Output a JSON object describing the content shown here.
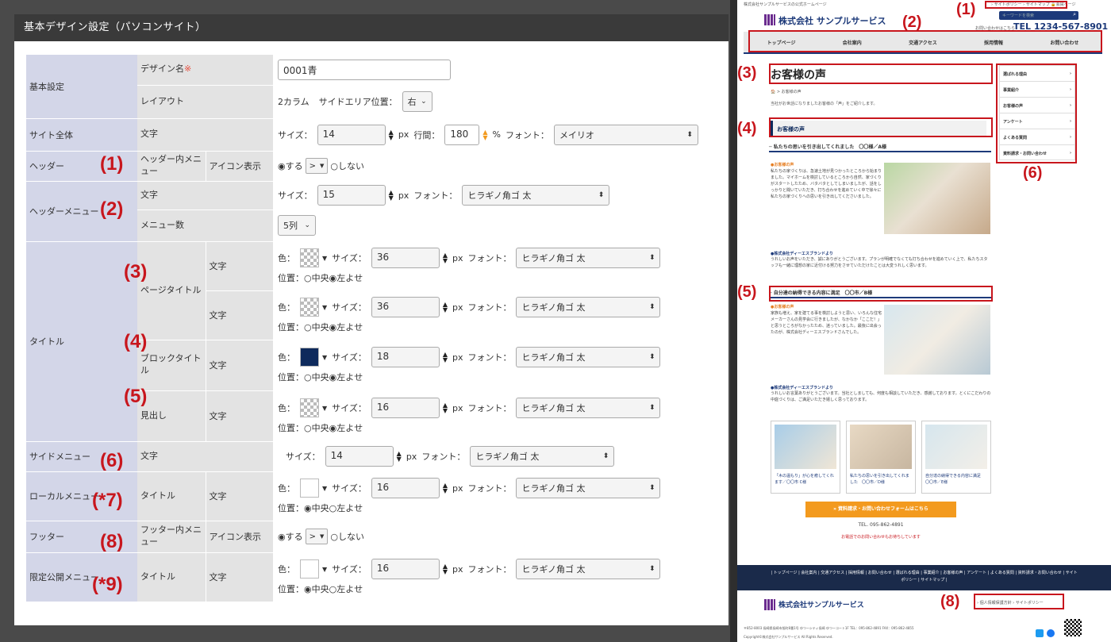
{
  "modal": {
    "title": "基本デザイン設定（パソコンサイト）"
  },
  "annotations": [
    "(1)",
    "(2)",
    "(3)",
    "(4)",
    "(5)",
    "(6)",
    "(*7)",
    "(8)",
    "(*9)"
  ],
  "rows": {
    "basic": {
      "section": "基本設定",
      "design_name_label": "デザイン名",
      "required_mark": "※",
      "design_name_value": "0001青",
      "layout_label": "レイアウト",
      "layout_value": "2カラム",
      "side_area_label": "サイドエリア位置：",
      "side_area_value": "右"
    },
    "site": {
      "section": "サイト全体",
      "sub": "文字",
      "size_label": "サイズ：",
      "size_value": "14",
      "px": "px",
      "line_label": "行間：",
      "line_value": "180",
      "pct": "%",
      "font_label": "フォント：",
      "font_value": "メイリオ"
    },
    "header": {
      "section": "ヘッダー",
      "sub": "ヘッダー内メニュー",
      "sub2": "アイコン表示",
      "yes": "◉する",
      "icon_value": ">",
      "no": "○しない"
    },
    "header_menu": {
      "section": "ヘッダーメニュー",
      "sub_text": "文字",
      "size_label": "サイズ：",
      "size_value": "15",
      "px": "px",
      "font_label": "フォント：",
      "font_value": "ヒラギノ角ゴ 太",
      "sub_count": "メニュー数",
      "count_value": "5列"
    },
    "title": {
      "section": "タイトル",
      "page_title": "ページタイトル",
      "block_title": "ブロックタイトル",
      "heading": "見出し",
      "sub_text": "文字",
      "color_label": "色：",
      "size_label": "サイズ：",
      "px": "px",
      "font_label": "フォント：",
      "font_value": "ヒラギノ角ゴ 太",
      "pos_left": "位置：○中央◉左よせ",
      "pos_center": "位置：◉中央○左よせ",
      "sizes": [
        "36",
        "36",
        "18",
        "16"
      ]
    },
    "side_menu": {
      "section": "サイドメニュー",
      "sub": "文字",
      "size_label": "サイズ：",
      "size_value": "14",
      "px": "px",
      "font_label": "フォント：",
      "font_value": "ヒラギノ角ゴ 太"
    },
    "local_menu": {
      "section": "ローカルメニュー",
      "sub": "タイトル",
      "sub2": "文字",
      "size_value": "16"
    },
    "footer": {
      "section": "フッター",
      "sub": "フッター内メニュー",
      "sub2": "アイコン表示",
      "yes": "◉する",
      "icon_value": ">",
      "no": "○しない"
    },
    "limited_menu": {
      "section": "限定公開メニュー",
      "sub": "タイトル",
      "sub2": "文字",
      "size_value": "16"
    }
  },
  "preview": {
    "top_small": "株式会社サンプルサービスの公式ホームページ",
    "top_links": "› サイトポリシー › サイトマップ 🔒会員ページ",
    "company": "株式会社 サンプルサービス",
    "search_placeholder": "キーワードを検索",
    "tel_small": "お問い合わせはこちら",
    "tel": "TEL 1234-567-8901",
    "nav": [
      "トップページ",
      "会社案内",
      "交通アクセス",
      "採用情報",
      "お問い合わせ"
    ],
    "page_title": "お客様の声",
    "breadcrumb": "🏠 > お客様の声",
    "intro": "当社がお世話になりましたお客様の「声」をご紹介します。",
    "block_title": "お客様の声",
    "heading1": "─ 私たちの思いを引き出してくれました　〇〇様／A様",
    "voice_label": "●お客様の声",
    "voice1": "私たちの家づくりは、急速土地が見つかったところから始まりました。マイホームを検討しているところから自然、家づくりがスタートしたため、バタバタとしてしまいましたが、話をしっかりと聞いていただき、打ち合わせを進めていく中で徐々に私たちの家づくりへの思いを引き出してくださいました。",
    "reply_label": "●株式会社ディーエスブランドより",
    "reply1": "うれしいお声をいただき、誠にありがとうございます。プランが明確でなくても打ち合わせを進めていく上で、私たちスタッフも一緒に理想の家に近付ける努力をさせていただけたことは大変うれしく思います。",
    "heading2": "─ 自分達の納得できる内容に満足　〇〇市／B様",
    "voice2": "家族も増え、家を建てる事を検討しようと思い、いろんな住宅メーカーさんの見学会に行きましたが、なかなか「ここだ！」と思うところがなかったため、迷っていました。最後に出会ったのが、株式会社ディーエスブランドさんでした。",
    "reply2": "うれしいお言葉ありがとうございます。当社としましても、何度も相談していただき、感謝しております。とくにこだわりの中庭づくりは、ご満足いただき嬉しく思っております。",
    "cards": [
      "「木の温もり」が心を癒してくれます／〇〇市 C様",
      "私たちの思いを引き出してくれました　〇〇市／D様",
      "自分達の納得できる内容に満足　〇〇市／E様"
    ],
    "cta": "» 資料請求・お問い合わせフォームはこちら",
    "tel_line": "TEL. 095-862-4891",
    "tel_note": "お電話でのお問い合わせもお待ちしています",
    "side": [
      "選ばれる理由",
      "事業紹介",
      "お客様の声",
      "アンケート",
      "よくある質問",
      "資料請求・お問い合わせ"
    ],
    "footer_links": "| トップページ | 会社案内 | 交通アクセス | 採用情報 | お問い合わせ | 選ばれる理由 | 事業紹介 | お客様の声 | アンケート | よくある質問 | 資料請求・お問い合わせ | サイトポリシー | サイトマップ |",
    "footer_company": "株式会社サンプルサービス",
    "footer_links2": "› 個人情報保護方針 › サイトポリシー",
    "address": "〒852-8003 長崎県長崎市旭町8番1号 ゆつーシティ長崎 ゆつーコート1F TEL：095-862-4891 FAX：095-862-4855",
    "copyright": "Copyright©株式会社サンプルサービス All Rights Reserved."
  },
  "colors": {
    "accent_red": "#c8161d",
    "label_blue": "#d3d6e8",
    "navy": "#0e2a5c",
    "orange": "#f39a1e",
    "footer_navy": "#1a2a4a"
  }
}
